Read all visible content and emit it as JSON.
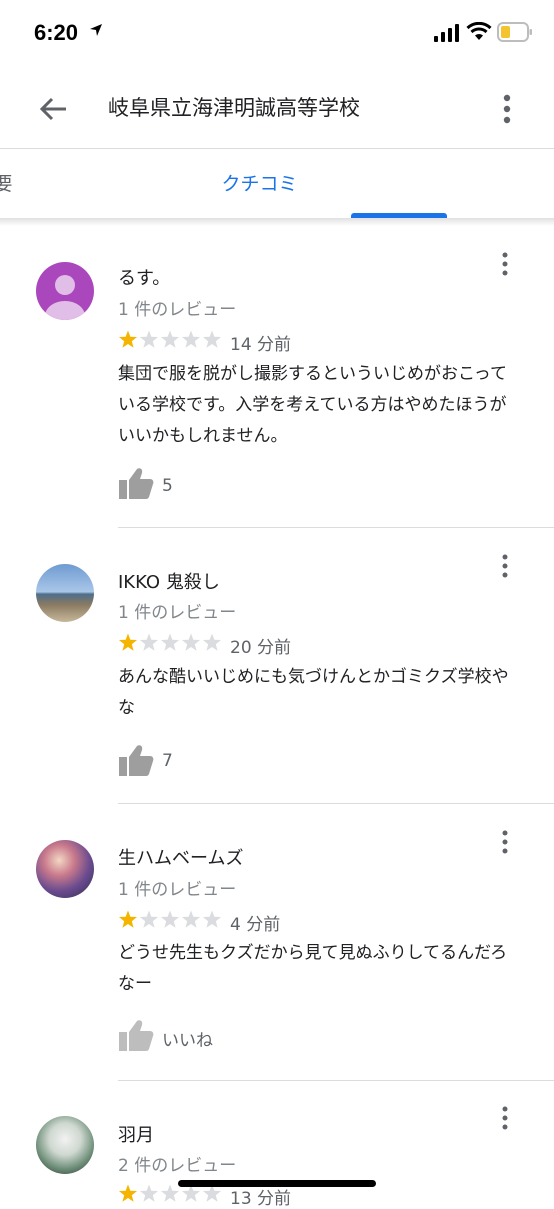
{
  "status": {
    "time": "6:20"
  },
  "header": {
    "title": "岐阜県立海津明誠高等学校"
  },
  "tabs": [
    {
      "label": "概要"
    },
    {
      "label": "クチコミ"
    }
  ],
  "reviews": [
    {
      "author": "るす。",
      "review_count": "1 件のレビュー",
      "rating": 1,
      "time": "14 分前",
      "text": "集団で服を脱がし撮影するといういじめがおこっている学校です。入学を考えている方はやめたほうがいいかもしれません。",
      "likes": "5"
    },
    {
      "author": "IKKO 鬼殺し",
      "review_count": "1 件のレビュー",
      "rating": 1,
      "time": "20 分前",
      "text": "あんな酷いいじめにも気づけんとかゴミクズ学校やな",
      "likes": "7"
    },
    {
      "author": "生ハムベームズ",
      "review_count": "1 件のレビュー",
      "rating": 1,
      "time": "4 分前",
      "text": "どうせ先生もクズだから見て見ぬふりしてるんだろなー",
      "likes": "いいね"
    },
    {
      "author": "羽月",
      "review_count": "2 件のレビュー",
      "rating": 1,
      "time": "13 分前",
      "text": "",
      "likes": ""
    }
  ],
  "colors": {
    "accent": "#1a73e8",
    "star": "#f4b400",
    "star_empty": "#dadce0"
  },
  "icons": [
    "back-arrow-icon",
    "more-vert-icon",
    "thumb-up-icon",
    "star-icon",
    "signal-icon",
    "wifi-icon",
    "battery-icon",
    "location-arrow-icon"
  ]
}
